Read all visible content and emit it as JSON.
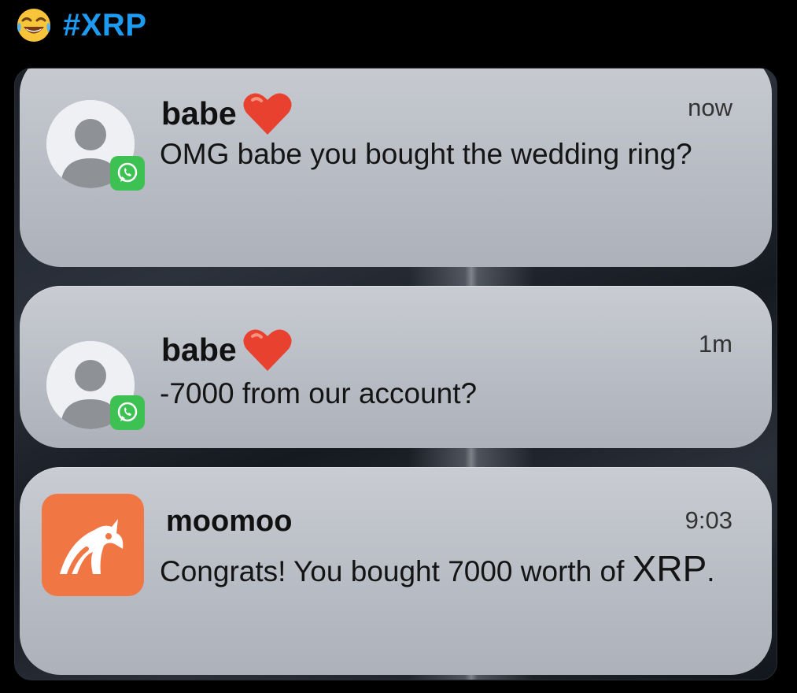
{
  "header": {
    "emoji_icon": "face-with-tears-of-joy-icon",
    "hashtag": "#XRP",
    "hashtag_color": "#1d9bf0"
  },
  "notifications": [
    {
      "sender": "babe",
      "sender_icon": "red-heart-icon",
      "app_icon": "whatsapp-icon",
      "time": "now",
      "message": "OMG babe you bought the wedding ring?"
    },
    {
      "sender": "babe",
      "sender_icon": "red-heart-icon",
      "app_icon": "whatsapp-icon",
      "time": "1m",
      "message": "-7000 from our account?"
    },
    {
      "sender": "moomoo",
      "app_icon": "moomoo-bull-icon",
      "time": "9:03",
      "message_prefix": "Congrats! You bought 7000 worth of ",
      "message_highlight": "XRP",
      "message_suffix": "."
    }
  ],
  "colors": {
    "card_background": "#c0c3ca",
    "whatsapp_green": "#3ec153",
    "moomoo_orange": "#f07643",
    "heart_red": "#e8412f"
  }
}
